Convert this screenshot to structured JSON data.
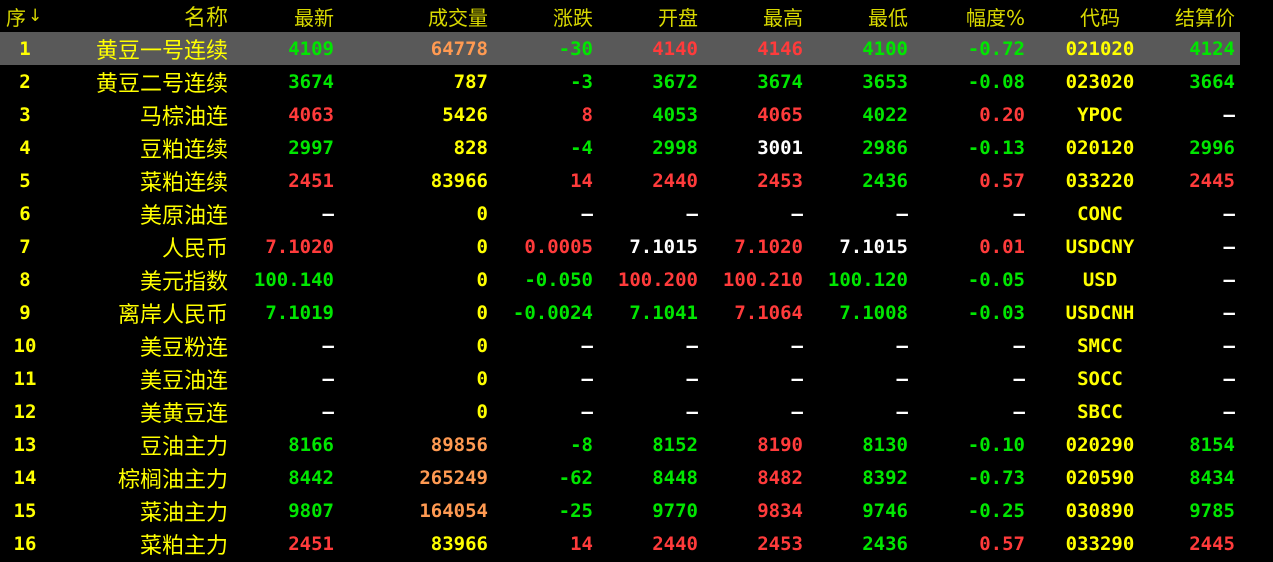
{
  "colors": {
    "up": "#ff3b3b",
    "down": "#00e600",
    "flat": "#ffffff",
    "label": "#ffff00",
    "volume_highlight": "#ff9a52",
    "selected_row_bg": "#595959"
  },
  "header": {
    "seq": "序",
    "sort_icon": "↓",
    "name": "名称",
    "last": "最新",
    "volume": "成交量",
    "change": "涨跌",
    "open": "开盘",
    "high": "最高",
    "low": "最低",
    "pct": "幅度%",
    "code": "代码",
    "settle": "结算价"
  },
  "rows": [
    {
      "seq": "1",
      "name": "黄豆一号连续",
      "last": "4109",
      "volume": "64778",
      "change": "-30",
      "open": "4140",
      "high": "4146",
      "low": "4100",
      "pct": "-0.72",
      "code": "021020",
      "settle": "4124"
    },
    {
      "seq": "2",
      "name": "黄豆二号连续",
      "last": "3674",
      "volume": "787",
      "change": "-3",
      "open": "3672",
      "high": "3674",
      "low": "3653",
      "pct": "-0.08",
      "code": "023020",
      "settle": "3664"
    },
    {
      "seq": "3",
      "name": "马棕油连",
      "last": "4063",
      "volume": "5426",
      "change": "8",
      "open": "4053",
      "high": "4065",
      "low": "4022",
      "pct": "0.20",
      "code": "YPOC",
      "settle": "—"
    },
    {
      "seq": "4",
      "name": "豆粕连续",
      "last": "2997",
      "volume": "828",
      "change": "-4",
      "open": "2998",
      "high": "3001",
      "low": "2986",
      "pct": "-0.13",
      "code": "020120",
      "settle": "2996"
    },
    {
      "seq": "5",
      "name": "菜粕连续",
      "last": "2451",
      "volume": "83966",
      "change": "14",
      "open": "2440",
      "high": "2453",
      "low": "2436",
      "pct": "0.57",
      "code": "033220",
      "settle": "2445"
    },
    {
      "seq": "6",
      "name": "美原油连",
      "last": "—",
      "volume": "0",
      "change": "—",
      "open": "—",
      "high": "—",
      "low": "—",
      "pct": "—",
      "code": "CONC",
      "settle": "—"
    },
    {
      "seq": "7",
      "name": "人民币",
      "last": "7.1020",
      "volume": "0",
      "change": "0.0005",
      "open": "7.1015",
      "high": "7.1020",
      "low": "7.1015",
      "pct": "0.01",
      "code": "USDCNY",
      "settle": "—"
    },
    {
      "seq": "8",
      "name": "美元指数",
      "last": "100.140",
      "volume": "0",
      "change": "-0.050",
      "open": "100.200",
      "high": "100.210",
      "low": "100.120",
      "pct": "-0.05",
      "code": "USD",
      "settle": "—"
    },
    {
      "seq": "9",
      "name": "离岸人民币",
      "last": "7.1019",
      "volume": "0",
      "change": "-0.0024",
      "open": "7.1041",
      "high": "7.1064",
      "low": "7.1008",
      "pct": "-0.03",
      "code": "USDCNH",
      "settle": "—"
    },
    {
      "seq": "10",
      "name": "美豆粉连",
      "last": "—",
      "volume": "0",
      "change": "—",
      "open": "—",
      "high": "—",
      "low": "—",
      "pct": "—",
      "code": "SMCC",
      "settle": "—"
    },
    {
      "seq": "11",
      "name": "美豆油连",
      "last": "—",
      "volume": "0",
      "change": "—",
      "open": "—",
      "high": "—",
      "low": "—",
      "pct": "—",
      "code": "SOCC",
      "settle": "—"
    },
    {
      "seq": "12",
      "name": "美黄豆连",
      "last": "—",
      "volume": "0",
      "change": "—",
      "open": "—",
      "high": "—",
      "low": "—",
      "pct": "—",
      "code": "SBCC",
      "settle": "—"
    },
    {
      "seq": "13",
      "name": "豆油主力",
      "last": "8166",
      "volume": "89856",
      "change": "-8",
      "open": "8152",
      "high": "8190",
      "low": "8130",
      "pct": "-0.10",
      "code": "020290",
      "settle": "8154"
    },
    {
      "seq": "14",
      "name": "棕榈油主力",
      "last": "8442",
      "volume": "265249",
      "change": "-62",
      "open": "8448",
      "high": "8482",
      "low": "8392",
      "pct": "-0.73",
      "code": "020590",
      "settle": "8434"
    },
    {
      "seq": "15",
      "name": "菜油主力",
      "last": "9807",
      "volume": "164054",
      "change": "-25",
      "open": "9770",
      "high": "9834",
      "low": "9746",
      "pct": "-0.25",
      "code": "030890",
      "settle": "9785"
    },
    {
      "seq": "16",
      "name": "菜粕主力",
      "last": "2451",
      "volume": "83966",
      "change": "14",
      "open": "2440",
      "high": "2453",
      "low": "2436",
      "pct": "0.57",
      "code": "033290",
      "settle": "2445"
    }
  ],
  "cell_colors": [
    {
      "last": "green",
      "volume": "orange",
      "change": "green",
      "open": "red",
      "high": "red",
      "low": "green",
      "pct": "green",
      "settle": "green"
    },
    {
      "last": "green",
      "volume": "yellow",
      "change": "green",
      "open": "green",
      "high": "green",
      "low": "green",
      "pct": "green",
      "settle": "green"
    },
    {
      "last": "red",
      "volume": "yellow",
      "change": "red",
      "open": "green",
      "high": "red",
      "low": "green",
      "pct": "red",
      "settle": "white"
    },
    {
      "last": "green",
      "volume": "yellow",
      "change": "green",
      "open": "green",
      "high": "white",
      "low": "green",
      "pct": "green",
      "settle": "green"
    },
    {
      "last": "red",
      "volume": "yellow",
      "change": "red",
      "open": "red",
      "high": "red",
      "low": "green",
      "pct": "red",
      "settle": "red"
    },
    {
      "last": "white",
      "volume": "yellow",
      "change": "white",
      "open": "white",
      "high": "white",
      "low": "white",
      "pct": "white",
      "settle": "white"
    },
    {
      "last": "red",
      "volume": "yellow",
      "change": "red",
      "open": "white",
      "high": "red",
      "low": "white",
      "pct": "red",
      "settle": "white"
    },
    {
      "last": "green",
      "volume": "yellow",
      "change": "green",
      "open": "red",
      "high": "red",
      "low": "green",
      "pct": "green",
      "settle": "white"
    },
    {
      "last": "green",
      "volume": "yellow",
      "change": "green",
      "open": "green",
      "high": "red",
      "low": "green",
      "pct": "green",
      "settle": "white"
    },
    {
      "last": "white",
      "volume": "yellow",
      "change": "white",
      "open": "white",
      "high": "white",
      "low": "white",
      "pct": "white",
      "settle": "white"
    },
    {
      "last": "white",
      "volume": "yellow",
      "change": "white",
      "open": "white",
      "high": "white",
      "low": "white",
      "pct": "white",
      "settle": "white"
    },
    {
      "last": "white",
      "volume": "yellow",
      "change": "white",
      "open": "white",
      "high": "white",
      "low": "white",
      "pct": "white",
      "settle": "white"
    },
    {
      "last": "green",
      "volume": "orange",
      "change": "green",
      "open": "green",
      "high": "red",
      "low": "green",
      "pct": "green",
      "settle": "green"
    },
    {
      "last": "green",
      "volume": "orange",
      "change": "green",
      "open": "green",
      "high": "red",
      "low": "green",
      "pct": "green",
      "settle": "green"
    },
    {
      "last": "green",
      "volume": "orange",
      "change": "green",
      "open": "green",
      "high": "red",
      "low": "green",
      "pct": "green",
      "settle": "green"
    },
    {
      "last": "red",
      "volume": "yellow",
      "change": "red",
      "open": "red",
      "high": "red",
      "low": "green",
      "pct": "red",
      "settle": "red"
    }
  ],
  "selected_row": 0
}
